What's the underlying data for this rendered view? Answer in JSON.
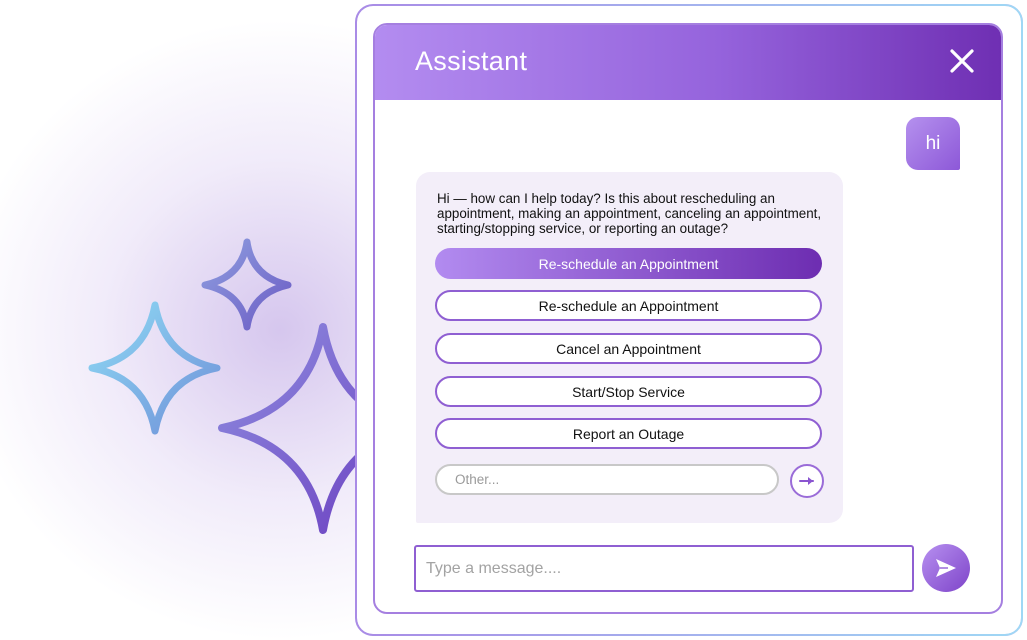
{
  "header": {
    "title": "Assistant",
    "close_icon": "close-icon"
  },
  "conversation": {
    "user_message": "hi",
    "bot_message": "Hi — how can I help today? Is this about rescheduling an appointment, making an appointment, canceling an appointment, starting/stopping service, or reporting an outage?",
    "options": [
      {
        "label": "Re-schedule an Appointment",
        "style": "primary"
      },
      {
        "label": "Re-schedule an Appointment",
        "style": "secondary"
      },
      {
        "label": "Cancel an Appointment",
        "style": "secondary"
      },
      {
        "label": "Start/Stop Service",
        "style": "secondary"
      },
      {
        "label": "Report an Outage",
        "style": "secondary"
      }
    ],
    "other_placeholder": "Other...",
    "other_send_icon": "arrow-right-icon"
  },
  "composer": {
    "placeholder": "Type a message....",
    "send_icon": "send-icon"
  },
  "colors": {
    "accent_light": "#b38cf0",
    "accent_dark": "#6f2fb3",
    "bubble_bg": "#f3eef9",
    "sparkle_blue": "#86d2f2",
    "sparkle_purple": "#7452c8"
  },
  "decorations": [
    "sparkle-icon",
    "sparkle-icon",
    "sparkle-icon"
  ]
}
